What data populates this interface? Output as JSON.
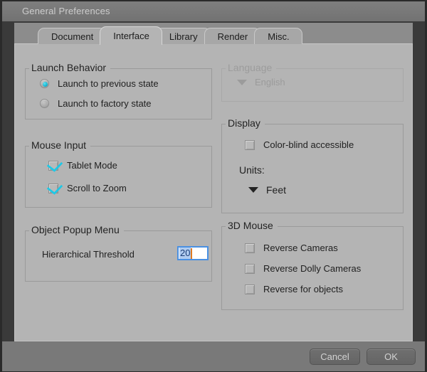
{
  "window": {
    "title": "General Preferences"
  },
  "tabs": [
    {
      "label": "Document",
      "active": false
    },
    {
      "label": "Interface",
      "active": true
    },
    {
      "label": "Library",
      "active": false
    },
    {
      "label": "Render",
      "active": false
    },
    {
      "label": "Misc.",
      "active": false
    }
  ],
  "groups": {
    "launch_behavior": {
      "title": "Launch Behavior",
      "options": [
        {
          "label": "Launch to previous state",
          "selected": true
        },
        {
          "label": "Launch to factory state",
          "selected": false
        }
      ]
    },
    "mouse_input": {
      "title": "Mouse Input",
      "checkboxes": [
        {
          "label": "Tablet Mode",
          "checked": true
        },
        {
          "label": "Scroll to Zoom",
          "checked": true
        }
      ]
    },
    "object_popup_menu": {
      "title": "Object Popup Menu",
      "threshold_label": "Hierarchical Threshold",
      "threshold_value": "20"
    },
    "language": {
      "title": "Language",
      "selected": "English",
      "disabled": true
    },
    "display": {
      "title": "Display",
      "colorblind": {
        "label": "Color-blind accessible",
        "checked": false
      },
      "units_label": "Units:",
      "units_value": "Feet"
    },
    "three_d_mouse": {
      "title": "3D Mouse",
      "checkboxes": [
        {
          "label": "Reverse Cameras",
          "checked": false
        },
        {
          "label": "Reverse Dolly Cameras",
          "checked": false
        },
        {
          "label": "Reverse for objects",
          "checked": false
        }
      ]
    }
  },
  "footer": {
    "cancel_label": "Cancel",
    "ok_label": "OK"
  },
  "colors": {
    "accent_cyan": "#1ec8e6",
    "focus_blue": "#4a90e2",
    "caret_orange": "#e07a20",
    "panel_bg": "#b4b4b4",
    "titlebar_bg": "#787878"
  }
}
